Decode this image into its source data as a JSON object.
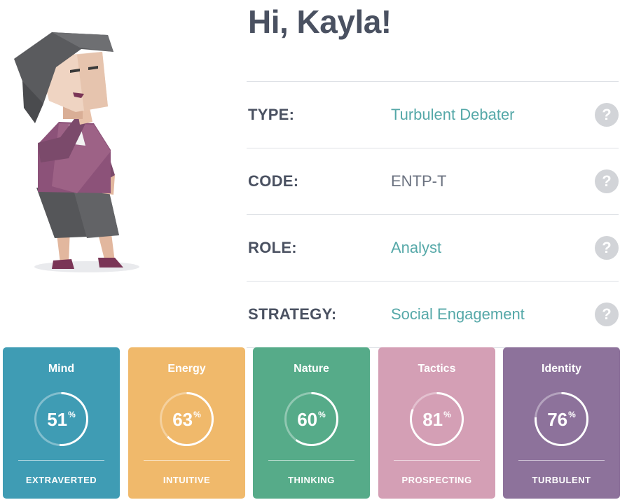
{
  "header": {
    "greeting": "Hi, Kayla!"
  },
  "avatar": {
    "icon": "woman-character-illustration"
  },
  "info_rows": [
    {
      "label": "TYPE:",
      "value": "Turbulent Debater",
      "help": "?"
    },
    {
      "label": "CODE:",
      "value": "ENTP-T",
      "help": "?"
    },
    {
      "label": "ROLE:",
      "value": "Analyst",
      "help": "?"
    },
    {
      "label": "STRATEGY:",
      "value": "Social Engagement",
      "help": "?"
    }
  ],
  "cards": [
    {
      "title": "Mind",
      "percent": "51",
      "suffix": "%",
      "trait": "EXTRAVERTED",
      "color": "#3f9cb4",
      "fraction": 0.51
    },
    {
      "title": "Energy",
      "percent": "63",
      "suffix": "%",
      "trait": "INTUITIVE",
      "color": "#f0b96b",
      "fraction": 0.63
    },
    {
      "title": "Nature",
      "percent": "60",
      "suffix": "%",
      "trait": "THINKING",
      "color": "#56ab89",
      "fraction": 0.6
    },
    {
      "title": "Tactics",
      "percent": "81",
      "suffix": "%",
      "trait": "PROSPECTING",
      "color": "#d49fb5",
      "fraction": 0.81
    },
    {
      "title": "Identity",
      "percent": "76",
      "suffix": "%",
      "trait": "TURBULENT",
      "color": "#8d729b",
      "fraction": 0.76
    }
  ]
}
